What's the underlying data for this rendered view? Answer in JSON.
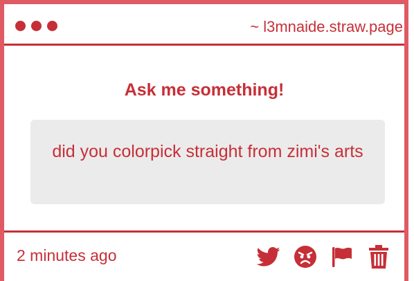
{
  "window": {
    "url": "~ l3mnaide.straw.page"
  },
  "main": {
    "heading": "Ask me something!",
    "question": "did you colorpick straight from zimi's arts"
  },
  "footer": {
    "timestamp": "2 minutes ago",
    "actions": [
      {
        "icon": "twitter-icon"
      },
      {
        "icon": "angry-face-icon"
      },
      {
        "icon": "flag-icon"
      },
      {
        "icon": "trash-icon"
      }
    ]
  },
  "colors": {
    "accent": "#c62f37",
    "border": "#e05a63",
    "question_bg": "#ecebeb"
  }
}
